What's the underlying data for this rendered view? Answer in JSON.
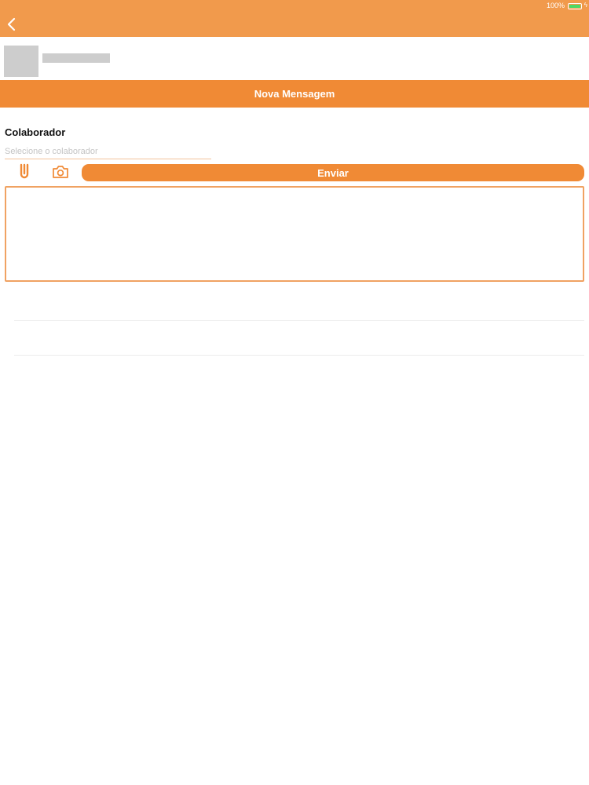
{
  "status_bar": {
    "battery_text": "100%"
  },
  "nav": {
    "back_icon": "chevron-left-icon"
  },
  "page": {
    "title": "Nova Mensagem"
  },
  "form": {
    "collaborator_label": "Colaborador",
    "collaborator_placeholder": "Selecione o colaborador",
    "collaborator_value": "",
    "attach_icon": "paperclip-icon",
    "camera_icon": "camera-icon",
    "send_label": "Enviar",
    "message_value": ""
  },
  "colors": {
    "accent": "#f08a35",
    "header": "#f19a4c",
    "field_border": "#f0a262",
    "placeholder": "#cdcdcd",
    "battery": "#4cd964"
  }
}
